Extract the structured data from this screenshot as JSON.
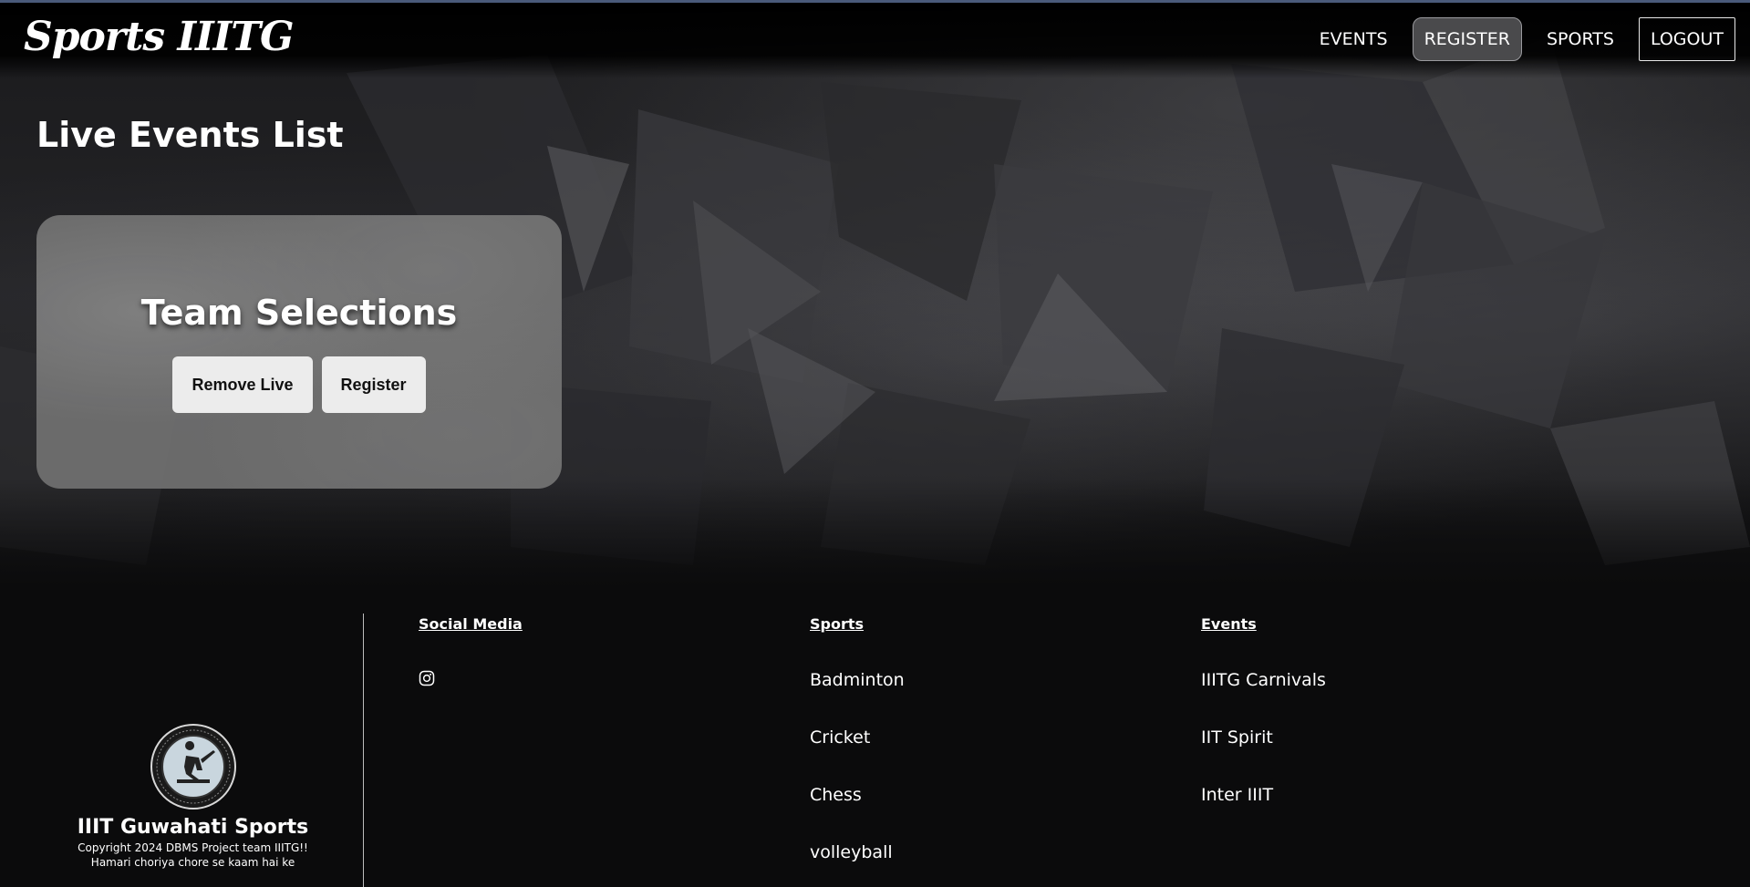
{
  "header": {
    "brand": "Sports IIITG",
    "nav": [
      {
        "label": "EVENTS",
        "active": false
      },
      {
        "label": "REGISTER",
        "active": true
      },
      {
        "label": "SPORTS",
        "active": false
      },
      {
        "label": "LOGOUT",
        "active": false
      }
    ]
  },
  "main": {
    "title": "Live Events List",
    "events": [
      {
        "title": "Team Selections",
        "actions": [
          "Remove Live",
          "Register"
        ]
      }
    ]
  },
  "footer": {
    "org_name": "IIIT Guwahati Sports",
    "copyright": "Copyright 2024 DBMS Project team IIITG!!",
    "tagline": "Hamari choriya chore se kaam hai ke",
    "logo_icon": "sports-board-logo",
    "columns": [
      {
        "heading": "Social Media",
        "items": [],
        "icons": [
          "instagram-icon"
        ]
      },
      {
        "heading": "Sports",
        "items": [
          "Badminton",
          "Cricket",
          "Chess",
          "volleyball"
        ]
      },
      {
        "heading": "Events",
        "items": [
          "IIITG Carnivals",
          "IIT Spirit",
          "Inter IIIT"
        ]
      }
    ]
  },
  "colors": {
    "page_bg": "#0b0b0c",
    "card_bg": "#707070",
    "button_bg": "#ececec",
    "nav_active_bg": "#4a4a4c",
    "top_accent": "#4a5a7a"
  }
}
